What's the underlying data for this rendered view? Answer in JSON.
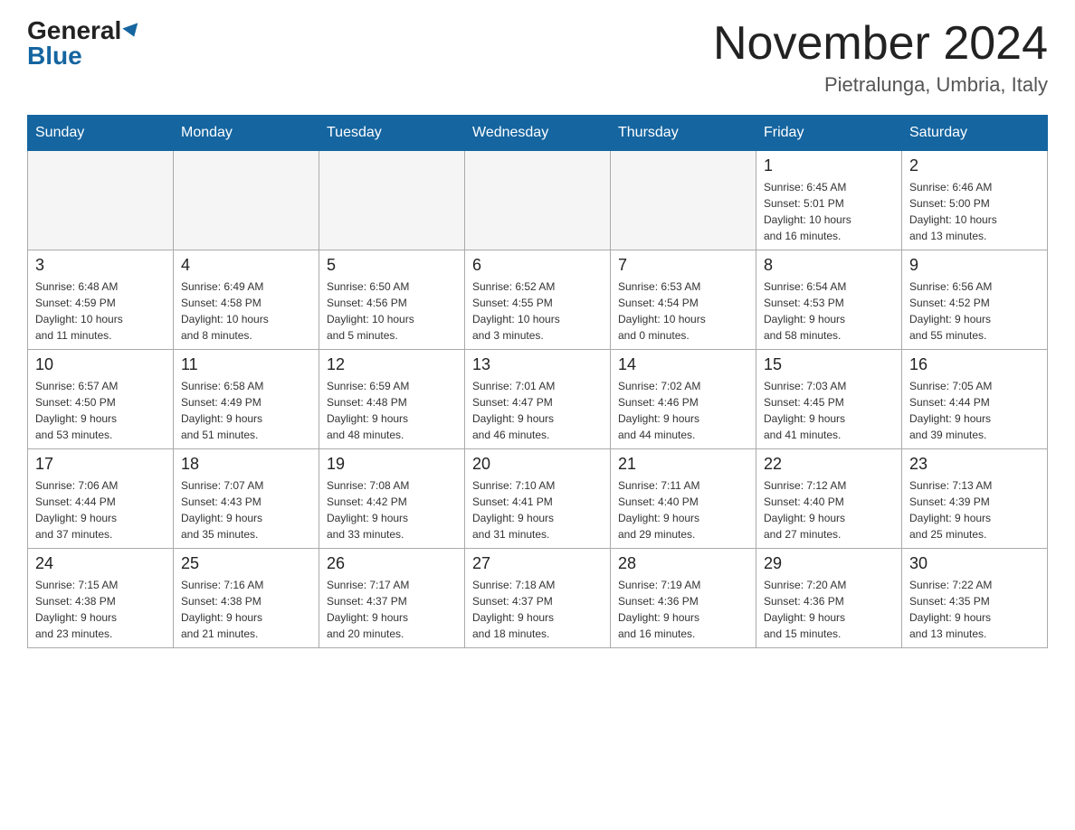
{
  "header": {
    "logo_general": "General",
    "logo_blue": "Blue",
    "month_title": "November 2024",
    "location": "Pietralunga, Umbria, Italy"
  },
  "days_of_week": [
    "Sunday",
    "Monday",
    "Tuesday",
    "Wednesday",
    "Thursday",
    "Friday",
    "Saturday"
  ],
  "weeks": [
    [
      {
        "day": "",
        "info": "",
        "empty": true
      },
      {
        "day": "",
        "info": "",
        "empty": true
      },
      {
        "day": "",
        "info": "",
        "empty": true
      },
      {
        "day": "",
        "info": "",
        "empty": true
      },
      {
        "day": "",
        "info": "",
        "empty": true
      },
      {
        "day": "1",
        "info": "Sunrise: 6:45 AM\nSunset: 5:01 PM\nDaylight: 10 hours\nand 16 minutes.",
        "empty": false
      },
      {
        "day": "2",
        "info": "Sunrise: 6:46 AM\nSunset: 5:00 PM\nDaylight: 10 hours\nand 13 minutes.",
        "empty": false
      }
    ],
    [
      {
        "day": "3",
        "info": "Sunrise: 6:48 AM\nSunset: 4:59 PM\nDaylight: 10 hours\nand 11 minutes.",
        "empty": false
      },
      {
        "day": "4",
        "info": "Sunrise: 6:49 AM\nSunset: 4:58 PM\nDaylight: 10 hours\nand 8 minutes.",
        "empty": false
      },
      {
        "day": "5",
        "info": "Sunrise: 6:50 AM\nSunset: 4:56 PM\nDaylight: 10 hours\nand 5 minutes.",
        "empty": false
      },
      {
        "day": "6",
        "info": "Sunrise: 6:52 AM\nSunset: 4:55 PM\nDaylight: 10 hours\nand 3 minutes.",
        "empty": false
      },
      {
        "day": "7",
        "info": "Sunrise: 6:53 AM\nSunset: 4:54 PM\nDaylight: 10 hours\nand 0 minutes.",
        "empty": false
      },
      {
        "day": "8",
        "info": "Sunrise: 6:54 AM\nSunset: 4:53 PM\nDaylight: 9 hours\nand 58 minutes.",
        "empty": false
      },
      {
        "day": "9",
        "info": "Sunrise: 6:56 AM\nSunset: 4:52 PM\nDaylight: 9 hours\nand 55 minutes.",
        "empty": false
      }
    ],
    [
      {
        "day": "10",
        "info": "Sunrise: 6:57 AM\nSunset: 4:50 PM\nDaylight: 9 hours\nand 53 minutes.",
        "empty": false
      },
      {
        "day": "11",
        "info": "Sunrise: 6:58 AM\nSunset: 4:49 PM\nDaylight: 9 hours\nand 51 minutes.",
        "empty": false
      },
      {
        "day": "12",
        "info": "Sunrise: 6:59 AM\nSunset: 4:48 PM\nDaylight: 9 hours\nand 48 minutes.",
        "empty": false
      },
      {
        "day": "13",
        "info": "Sunrise: 7:01 AM\nSunset: 4:47 PM\nDaylight: 9 hours\nand 46 minutes.",
        "empty": false
      },
      {
        "day": "14",
        "info": "Sunrise: 7:02 AM\nSunset: 4:46 PM\nDaylight: 9 hours\nand 44 minutes.",
        "empty": false
      },
      {
        "day": "15",
        "info": "Sunrise: 7:03 AM\nSunset: 4:45 PM\nDaylight: 9 hours\nand 41 minutes.",
        "empty": false
      },
      {
        "day": "16",
        "info": "Sunrise: 7:05 AM\nSunset: 4:44 PM\nDaylight: 9 hours\nand 39 minutes.",
        "empty": false
      }
    ],
    [
      {
        "day": "17",
        "info": "Sunrise: 7:06 AM\nSunset: 4:44 PM\nDaylight: 9 hours\nand 37 minutes.",
        "empty": false
      },
      {
        "day": "18",
        "info": "Sunrise: 7:07 AM\nSunset: 4:43 PM\nDaylight: 9 hours\nand 35 minutes.",
        "empty": false
      },
      {
        "day": "19",
        "info": "Sunrise: 7:08 AM\nSunset: 4:42 PM\nDaylight: 9 hours\nand 33 minutes.",
        "empty": false
      },
      {
        "day": "20",
        "info": "Sunrise: 7:10 AM\nSunset: 4:41 PM\nDaylight: 9 hours\nand 31 minutes.",
        "empty": false
      },
      {
        "day": "21",
        "info": "Sunrise: 7:11 AM\nSunset: 4:40 PM\nDaylight: 9 hours\nand 29 minutes.",
        "empty": false
      },
      {
        "day": "22",
        "info": "Sunrise: 7:12 AM\nSunset: 4:40 PM\nDaylight: 9 hours\nand 27 minutes.",
        "empty": false
      },
      {
        "day": "23",
        "info": "Sunrise: 7:13 AM\nSunset: 4:39 PM\nDaylight: 9 hours\nand 25 minutes.",
        "empty": false
      }
    ],
    [
      {
        "day": "24",
        "info": "Sunrise: 7:15 AM\nSunset: 4:38 PM\nDaylight: 9 hours\nand 23 minutes.",
        "empty": false
      },
      {
        "day": "25",
        "info": "Sunrise: 7:16 AM\nSunset: 4:38 PM\nDaylight: 9 hours\nand 21 minutes.",
        "empty": false
      },
      {
        "day": "26",
        "info": "Sunrise: 7:17 AM\nSunset: 4:37 PM\nDaylight: 9 hours\nand 20 minutes.",
        "empty": false
      },
      {
        "day": "27",
        "info": "Sunrise: 7:18 AM\nSunset: 4:37 PM\nDaylight: 9 hours\nand 18 minutes.",
        "empty": false
      },
      {
        "day": "28",
        "info": "Sunrise: 7:19 AM\nSunset: 4:36 PM\nDaylight: 9 hours\nand 16 minutes.",
        "empty": false
      },
      {
        "day": "29",
        "info": "Sunrise: 7:20 AM\nSunset: 4:36 PM\nDaylight: 9 hours\nand 15 minutes.",
        "empty": false
      },
      {
        "day": "30",
        "info": "Sunrise: 7:22 AM\nSunset: 4:35 PM\nDaylight: 9 hours\nand 13 minutes.",
        "empty": false
      }
    ]
  ]
}
